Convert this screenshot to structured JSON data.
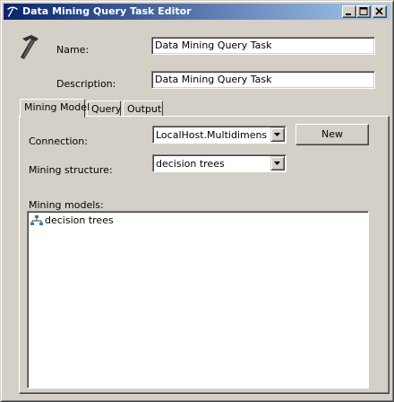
{
  "window": {
    "title": "Data Mining Query Task Editor",
    "icons": {
      "title": "pickaxe-icon",
      "header": "hammer-icon"
    }
  },
  "form": {
    "name_label": "Name:",
    "name_value": "Data Mining Query Task",
    "description_label": "Description:",
    "description_value": "Data Mining Query Task"
  },
  "tabs": [
    {
      "label": "Mining Model",
      "active": true
    },
    {
      "label": "Query",
      "active": false
    },
    {
      "label": "Output",
      "active": false
    }
  ],
  "mining_model": {
    "connection_label": "Connection:",
    "connection_value": "LocalHost.MultidimensionalP",
    "new_button": "New",
    "structure_label": "Mining structure:",
    "structure_value": "decision trees",
    "models_label": "Mining models:",
    "models": [
      {
        "label": "decision trees",
        "icon": "tree-model-icon"
      }
    ]
  }
}
